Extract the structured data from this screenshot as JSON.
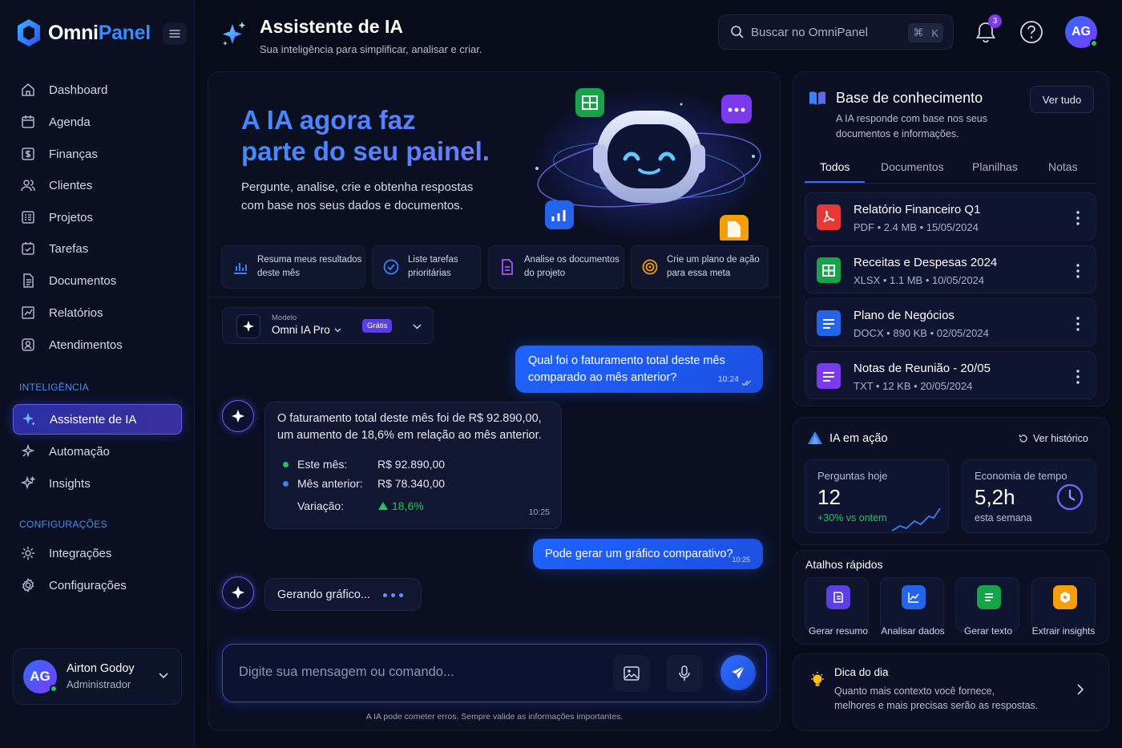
{
  "app": {
    "name_main": "Omni",
    "name_accent": "Panel"
  },
  "sidebar": {
    "items": [
      {
        "label": "Dashboard",
        "icon": "home-icon"
      },
      {
        "label": "Agenda",
        "icon": "calendar-icon"
      },
      {
        "label": "Finanças",
        "icon": "finance-icon"
      },
      {
        "label": "Clientes",
        "icon": "users-icon"
      },
      {
        "label": "Projetos",
        "icon": "projects-icon"
      },
      {
        "label": "Tarefas",
        "icon": "tasks-icon"
      },
      {
        "label": "Documentos",
        "icon": "document-icon"
      },
      {
        "label": "Relatórios",
        "icon": "reports-icon"
      },
      {
        "label": "Atendimentos",
        "icon": "support-icon"
      }
    ],
    "section_intel": "INTELIGÊNCIA",
    "intel_items": [
      {
        "label": "Assistente de IA",
        "icon": "sparkle-icon"
      },
      {
        "label": "Automação",
        "icon": "automation-icon"
      },
      {
        "label": "Insights",
        "icon": "insights-icon"
      }
    ],
    "section_config": "CONFIGURAÇÕES",
    "config_items": [
      {
        "label": "Integrações",
        "icon": "integrations-icon"
      },
      {
        "label": "Configurações",
        "icon": "settings-icon"
      }
    ],
    "user": {
      "initials": "AG",
      "name": "Airton Godoy",
      "role": "Administrador"
    }
  },
  "header": {
    "title": "Assistente de IA",
    "subtitle": "Sua inteligência para simplificar, analisar e criar.",
    "search_placeholder": "Buscar no OmniPanel",
    "shortcut_cmd": "⌘",
    "shortcut_key": "K",
    "notifications": "3",
    "avatar": "AG"
  },
  "hero": {
    "title_line1": "A IA agora faz",
    "title_line2": "parte do seu painel.",
    "text_line1": "Pergunte, analise, crie e obtenha respostas",
    "text_line2": "com base nos seus dados e documentos."
  },
  "suggestions": [
    {
      "line1": "Resuma meus resultados",
      "line2": "deste mês"
    },
    {
      "line1": "Liste tarefas",
      "line2": "prioritárias"
    },
    {
      "line1": "Analise os documentos",
      "line2": "do projeto"
    },
    {
      "line1": "Crie um plano de ação",
      "line2": "para essa meta"
    }
  ],
  "model": {
    "caption": "Modelo",
    "name": "Omni IA Pro",
    "badge": "Grátis"
  },
  "chat": {
    "user1_line1": "Qual foi o faturamento total deste mês",
    "user1_line2": "comparado ao mês anterior?",
    "user1_time": "10:24",
    "ai1_line1": "O faturamento total deste mês foi de R$ 92.890,00,",
    "ai1_line2": "um aumento de 18,6% em relação ao mês anterior.",
    "ai1_rows": [
      {
        "label": "Este mês:",
        "value": "R$ 92.890,00",
        "color": "#22c55e"
      },
      {
        "label": "Mês anterior:",
        "value": "R$ 78.340,00",
        "color": "#3b82f6"
      }
    ],
    "ai1_var_label": "Variação:",
    "ai1_var_value": "18,6%",
    "ai1_time": "10:25",
    "user2": "Pode gerar um gráfico comparativo?",
    "user2_time": "10:25",
    "ai2": "Gerando gráfico...",
    "input_placeholder": "Digite sua mensagem ou comando...",
    "disclaimer": "A IA pode cometer erros. Sempre valide as informações importantes."
  },
  "kb": {
    "title": "Base de conhecimento",
    "desc_line1": "A IA responde com base nos seus",
    "desc_line2": "documentos e informações.",
    "view_all": "Ver tudo",
    "tabs": [
      "Todos",
      "Documentos",
      "Planilhas",
      "Notas"
    ],
    "docs": [
      {
        "name": "Relatório Financeiro Q1",
        "meta": "PDF • 2.4 MB • 15/05/2024",
        "color": "#e53935"
      },
      {
        "name": "Receitas e Despesas 2024",
        "meta": "XLSX • 1.1 MB • 10/05/2024",
        "color": "#16a34a"
      },
      {
        "name": "Plano de Negócios",
        "meta": "DOCX • 890 KB • 02/05/2024",
        "color": "#2563eb"
      },
      {
        "name": "Notas de Reunião - 20/05",
        "meta": "TXT • 12 KB • 20/05/2024",
        "color": "#7c3aed"
      }
    ]
  },
  "ai_action": {
    "title": "IA em ação",
    "history": "Ver histórico",
    "q_label": "Perguntas hoje",
    "q_value": "12",
    "q_delta": "+30% vs ontem",
    "t_label": "Economia de tempo",
    "t_value": "5,2h",
    "t_sub": "esta semana"
  },
  "shortcuts": {
    "title": "Atalhos rápidos",
    "items": [
      {
        "label": "Gerar resumo",
        "color": "#5b3fe0"
      },
      {
        "label": "Analisar dados",
        "color": "#2563eb"
      },
      {
        "label": "Gerar texto",
        "color": "#16a34a"
      },
      {
        "label": "Extrair insights",
        "color": "#f59e0b"
      }
    ]
  },
  "tip": {
    "title": "Dica do dia",
    "line1": "Quanto mais contexto você fornece,",
    "line2": "melhores e mais precisas serão as respostas."
  }
}
